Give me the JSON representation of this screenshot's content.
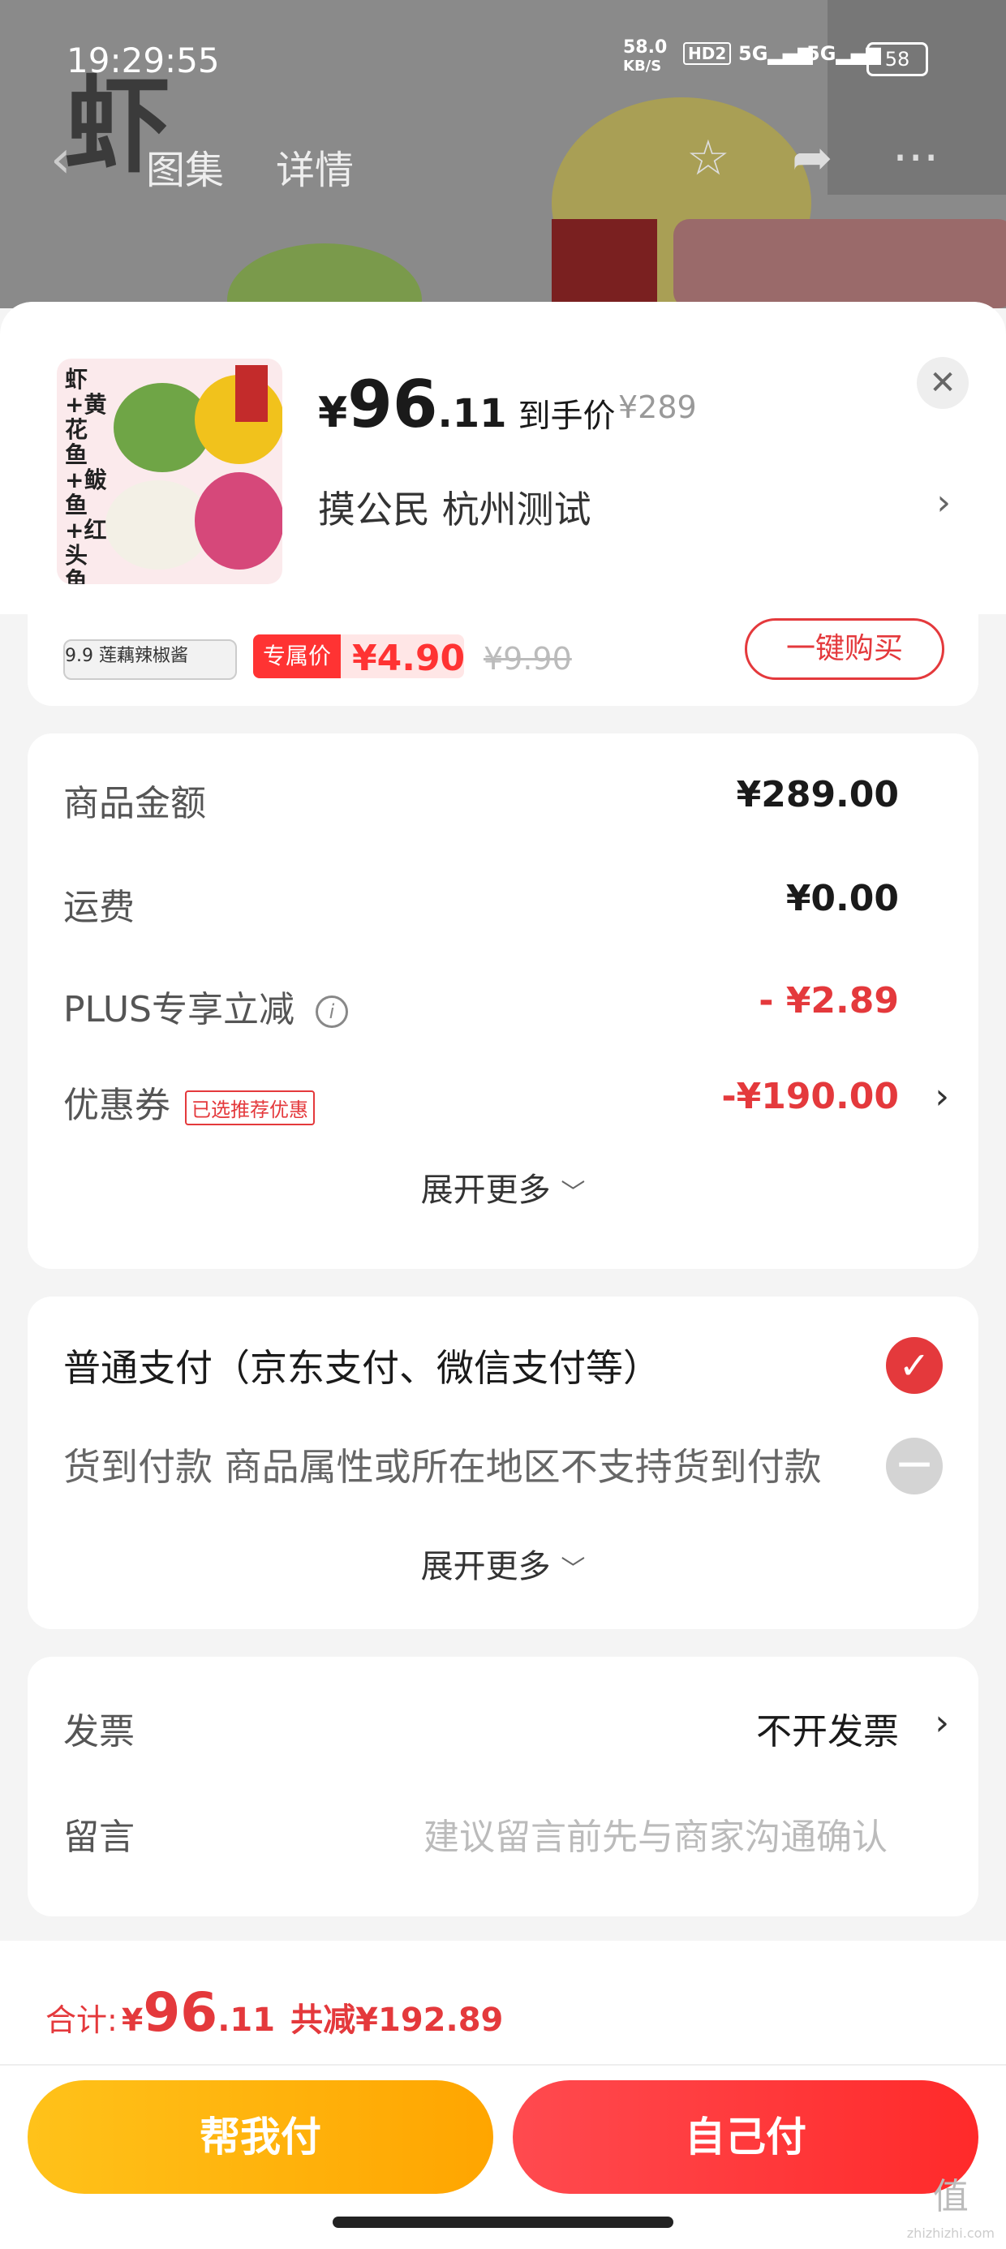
{
  "status_bar": {
    "time": "19:29:55",
    "net_speed": "58.0",
    "net_unit": "KB/S",
    "hd": "HD2",
    "sig1": "5G",
    "sig2": "5G",
    "battery": "58"
  },
  "nav": {
    "tab_gallery": "图集",
    "tab_detail": "详情"
  },
  "background": {
    "art_text": "虾"
  },
  "product": {
    "price_int": "96",
    "price_dec": ".11",
    "price_yen": "¥",
    "price_label": "到手价",
    "original_price": "¥289",
    "address": "摸公民  杭州测试",
    "thumb_text": "虾+黄花鱼+鲅鱼+红头鱼"
  },
  "promo": {
    "img_text": "9.9 莲藕辣椒酱",
    "tag": "专属价",
    "price": "¥4.90",
    "old_price": "¥9.90",
    "button": "一键购买"
  },
  "summary": {
    "rows": [
      {
        "label": "商品金额",
        "value": "¥289.00"
      },
      {
        "label": "运费",
        "value": "¥0.00"
      },
      {
        "label": "PLUS专享立减",
        "value": "- ¥2.89"
      },
      {
        "label": "优惠券",
        "badge": "已选推荐优惠",
        "value": "-¥190.00"
      }
    ],
    "expand": "展开更多"
  },
  "payment": {
    "options": [
      {
        "label": "普通支付（京东支付、微信支付等）",
        "state": "selected"
      },
      {
        "label": "货到付款 商品属性或所在地区不支持货到付款",
        "state": "disabled"
      }
    ],
    "expand": "展开更多"
  },
  "extra": {
    "invoice_label": "发票",
    "invoice_value": "不开发票",
    "note_label": "留言",
    "note_placeholder": "建议留言前先与商家沟通确认"
  },
  "footer": {
    "total_label": "合计:",
    "total_yen": "¥",
    "total_int": "96",
    "total_dec": ".11",
    "savings": "共减¥192.89",
    "btn_help": "帮我付",
    "btn_self": "自己付"
  },
  "watermark": {
    "line1": "值",
    "line2": "zhizhizhi.com"
  },
  "colors": {
    "accent": "#e4393c",
    "help_btn": "#ffb300",
    "self_btn": "#ff3333"
  }
}
